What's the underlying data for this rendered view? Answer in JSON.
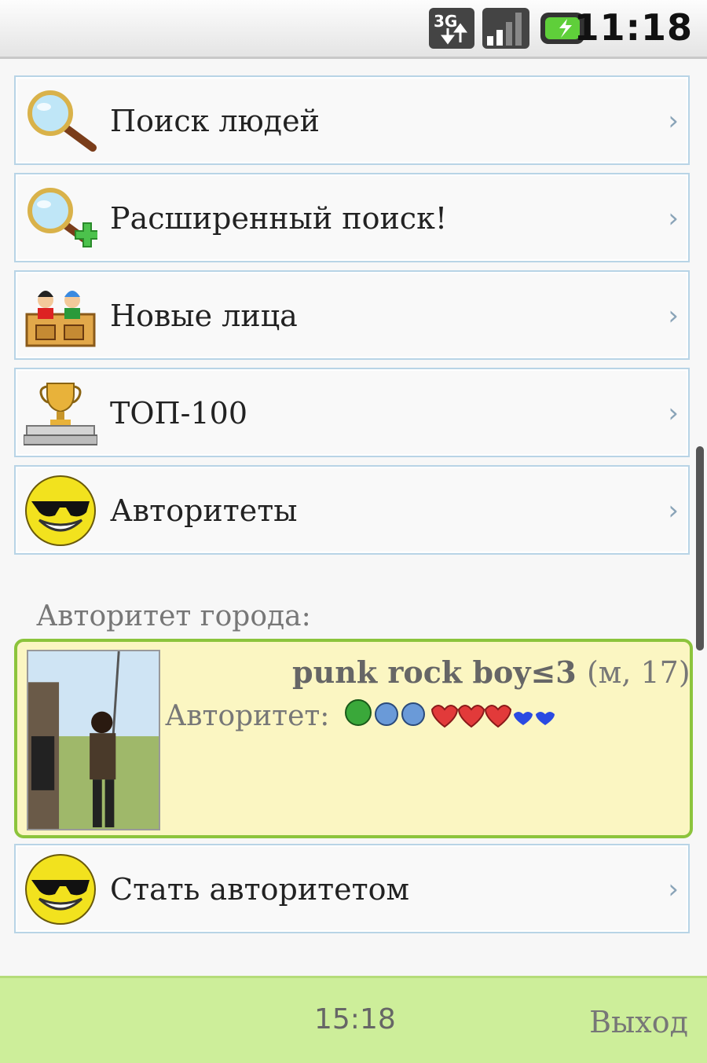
{
  "status_bar": {
    "network": "3G",
    "time": "11:18"
  },
  "menu": [
    {
      "label": "Поиск людей",
      "icon": "magnifier-icon"
    },
    {
      "label": "Расширенный поиск!",
      "icon": "magnifier-plus-icon"
    },
    {
      "label": "Новые лица",
      "icon": "new-faces-icon"
    },
    {
      "label": "ТОП-100",
      "icon": "trophy-icon"
    },
    {
      "label": "Авторитеты",
      "icon": "sunglasses-smiley-icon"
    }
  ],
  "city_authority": {
    "section_title": "Авторитет города:",
    "user_name": "punk rock boy≤3",
    "user_meta": "(м, 17)",
    "rating_label": "Авторитет:"
  },
  "become": {
    "label": "Стать авторитетом",
    "icon": "sunglasses-smiley-icon"
  },
  "chevron": "›",
  "footer": {
    "time": "15:18",
    "exit_label": "Выход"
  },
  "colors": {
    "item_border": "#b8d4e6",
    "card_bg": "#fbf6c2",
    "card_border": "#8cc43c",
    "footer_bg": "#cdee9a"
  }
}
